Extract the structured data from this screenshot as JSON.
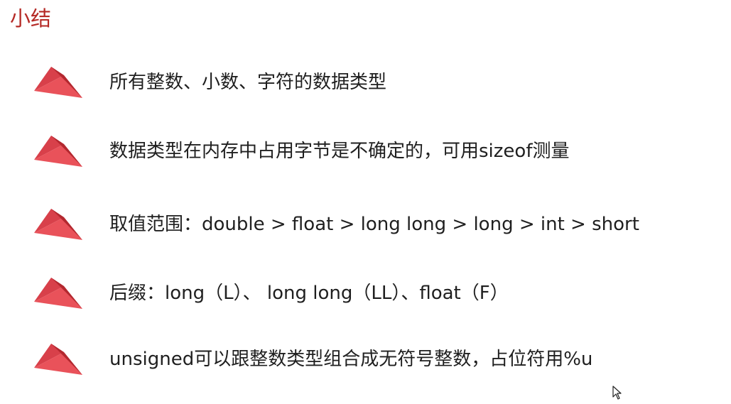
{
  "slide": {
    "title": "小结",
    "bullets": [
      {
        "text": "所有整数、小数、字符的数据类型"
      },
      {
        "text": "数据类型在内存中占用字节是不确定的，可用sizeof测量"
      },
      {
        "text": "取值范围：double > float > long long >  long > int > short"
      },
      {
        "text": "后缀：long（L）、 long long（LL）、float（F）"
      },
      {
        "text": "unsigned可以跟整数类型组合成无符号整数，占位符用%u"
      }
    ]
  },
  "colors": {
    "title": "#b52a26",
    "bullet_light": "#e9525a",
    "bullet_dark": "#b3282f",
    "text": "#1f1f1f"
  },
  "icons": {
    "bullet": "red-triangle-icon",
    "cursor": "mouse-pointer-icon"
  }
}
